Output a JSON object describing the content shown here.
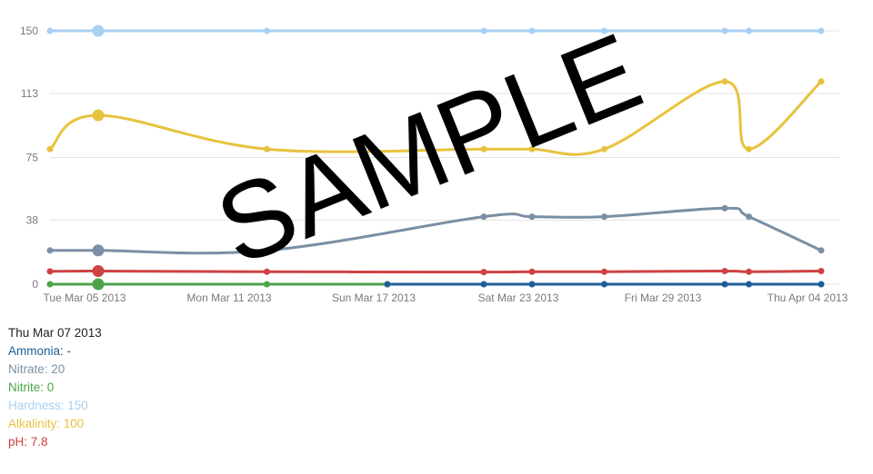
{
  "chart_data": {
    "type": "line",
    "x_ticks": [
      "Tue Mar 05 2013",
      "Mon Mar 11 2013",
      "Sun Mar 17 2013",
      "Sat Mar 23 2013",
      "Fri Mar 29 2013",
      "Thu Apr 04 2013"
    ],
    "y_ticks": [
      "0",
      "38",
      "75",
      "113",
      "150"
    ],
    "ylim": [
      0,
      150
    ],
    "xlim": [
      "2013-03-05",
      "2013-04-04"
    ],
    "grid": true,
    "highlight_x": "2013-03-07",
    "series": [
      {
        "key": "hardness",
        "color": "#a9d1f2",
        "x": [
          "2013-03-05",
          "2013-03-07",
          "2013-03-14",
          "2013-03-23",
          "2013-03-25",
          "2013-03-28",
          "2013-04-02",
          "2013-04-03",
          "2013-04-06"
        ],
        "y": [
          150,
          150,
          150,
          150,
          150,
          150,
          150,
          150,
          150
        ]
      },
      {
        "key": "alkalinity",
        "color": "#e8c23f",
        "x": [
          "2013-03-05",
          "2013-03-07",
          "2013-03-14",
          "2013-03-23",
          "2013-03-25",
          "2013-03-28",
          "2013-04-02",
          "2013-04-03",
          "2013-04-06"
        ],
        "y": [
          80,
          100,
          80,
          80,
          80,
          80,
          120,
          80,
          120
        ]
      },
      {
        "key": "nitrate",
        "color": "#7a8fa3",
        "x": [
          "2013-03-05",
          "2013-03-07",
          "2013-03-14",
          "2013-03-23",
          "2013-03-25",
          "2013-03-28",
          "2013-04-02",
          "2013-04-03",
          "2013-04-06"
        ],
        "y": [
          20,
          20,
          20,
          40,
          40,
          40,
          45,
          40,
          20
        ]
      },
      {
        "key": "ph",
        "color": "#cf4242",
        "x": [
          "2013-03-05",
          "2013-03-07",
          "2013-03-14",
          "2013-03-23",
          "2013-03-25",
          "2013-03-28",
          "2013-04-02",
          "2013-04-03",
          "2013-04-06"
        ],
        "y": [
          7.6,
          7.8,
          7.4,
          7.2,
          7.4,
          7.4,
          7.8,
          7.4,
          7.8
        ]
      },
      {
        "key": "nitrite",
        "color": "#4aa548",
        "x": [
          "2013-03-05",
          "2013-03-07",
          "2013-03-14",
          "2013-03-19"
        ],
        "y": [
          0,
          0,
          0,
          0
        ]
      },
      {
        "key": "ammonia",
        "color": "#1d5e99",
        "x": [
          "2013-03-19",
          "2013-03-23",
          "2013-03-25",
          "2013-03-28",
          "2013-04-02",
          "2013-04-03",
          "2013-04-06"
        ],
        "y": [
          0,
          0,
          0,
          0,
          0,
          0,
          0
        ]
      }
    ]
  },
  "tooltip": {
    "date": "Thu Mar 07 2013",
    "ammonia": "Ammonia: -",
    "nitrate": "Nitrate: 20",
    "nitrite": "Nitrite: 0",
    "hardness": "Hardness: 150",
    "alkalinity": "Alkalinity: 100",
    "ph": "pH: 7.8"
  },
  "watermark": "SAMPLE"
}
